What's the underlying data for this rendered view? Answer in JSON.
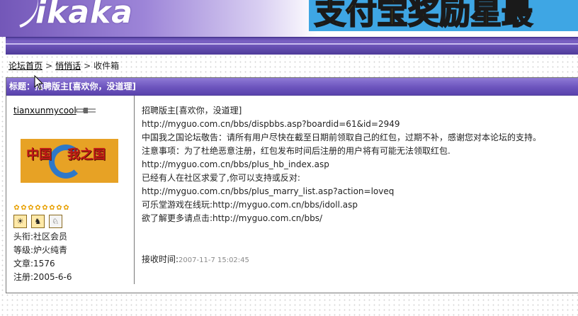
{
  "header": {
    "logo_text": "ikaka",
    "banner_text": "支付宝奖励星最"
  },
  "breadcrumb": {
    "items": [
      "论坛首页",
      "悄悄话",
      "收件箱"
    ],
    "separator": ">"
  },
  "message": {
    "title": "标题：招聘版主[喜欢你，没道理]",
    "sender": {
      "username": "tianxunmycool",
      "avatar_text": [
        "中国",
        "我之国"
      ],
      "stars": 8,
      "star_glyph": "✿",
      "badges": [
        "sun-badge-icon",
        "squirrel-badge-icon",
        "dog-badge-icon"
      ],
      "title_line": "头衔:社区会员",
      "level_line": "等级:炉火纯青",
      "posts_line": "文章:1576",
      "registered_line": "注册:2005-6-6"
    },
    "body_lines": [
      "招聘版主[喜欢你，没道理]",
      "http://myguo.com.cn/bbs/dispbbs.asp?boardid=61&id=2949",
      "中国我之国论坛敬告：请所有用户尽快在截至日期前领取自己的红包，过期不补，感谢您对本论坛的支持。",
      "注意事项：为了杜绝恶意注册，红包发布时间后注册的用户将有可能无法领取红包.",
      "http://myguo.com.cn/bbs/plus_hb_index.asp",
      "已经有人在社区求爱了,你可以支持或反对:",
      "http://myguo.com.cn/bbs/plus_marry_list.asp?action=loveq",
      "可乐堂游戏在线玩:http://myguo.com.cn/bbs/idoll.asp",
      "欲了解更多请点击:http://myguo.com.cn/bbs/"
    ],
    "received_label": "接收时间:",
    "received_time": "2007-11-7 15:02:45"
  },
  "colors": {
    "title_bar": "#6c54bd",
    "header_bar": "#5a45a6",
    "timestamp": "#8a8a8a"
  }
}
